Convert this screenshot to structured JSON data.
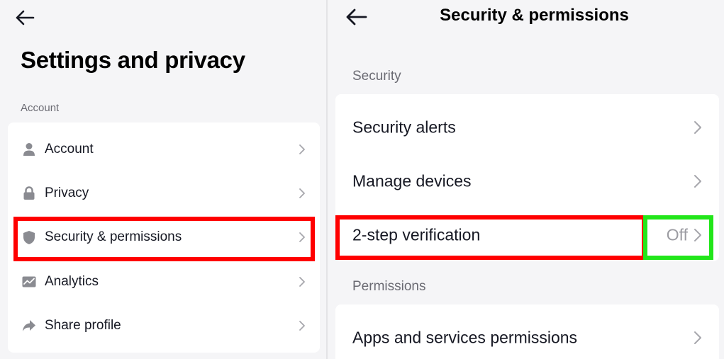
{
  "left": {
    "title": "Settings and privacy",
    "section_label": "Account",
    "items": [
      {
        "label": "Account",
        "icon": "person-icon"
      },
      {
        "label": "Privacy",
        "icon": "lock-icon"
      },
      {
        "label": "Security & permissions",
        "icon": "shield-icon"
      },
      {
        "label": "Analytics",
        "icon": "analytics-icon"
      },
      {
        "label": "Share profile",
        "icon": "share-icon"
      }
    ]
  },
  "right": {
    "title": "Security & permissions",
    "security_label": "Security",
    "security_items": [
      {
        "label": "Security alerts"
      },
      {
        "label": "Manage devices"
      },
      {
        "label": "2-step verification",
        "value": "Off"
      }
    ],
    "permissions_label": "Permissions",
    "permission_items": [
      {
        "label": "Apps and services permissions"
      }
    ]
  },
  "colors": {
    "highlight_red": "#ff0000",
    "highlight_green": "#22e61a",
    "background": "#f5f5f7",
    "card": "#ffffff"
  }
}
